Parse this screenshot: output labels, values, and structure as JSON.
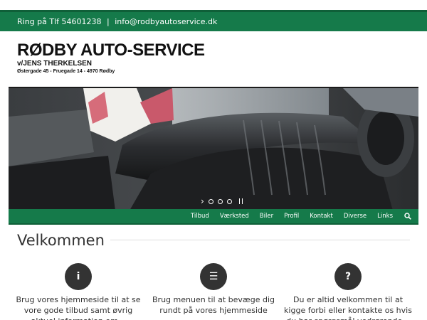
{
  "topbar": {
    "phone": "Ring på Tlf 54601238",
    "separator": "|",
    "email": "info@rodbyautoservice.dk"
  },
  "logo": {
    "title": "RØDBY AUTO-SERVICE",
    "subtitle": "v/JENS THERKELSEN",
    "address": "Østergade 45 - Fruegade 14 - 4970 Rødby"
  },
  "hero": {
    "next_arrow": "›",
    "dot_count": 3
  },
  "nav": {
    "items": [
      {
        "label": "Tilbud"
      },
      {
        "label": "Værksted"
      },
      {
        "label": "Biler"
      },
      {
        "label": "Profil"
      },
      {
        "label": "Kontakt"
      },
      {
        "label": "Diverse"
      },
      {
        "label": "Links"
      }
    ],
    "search_icon": "search-icon"
  },
  "welcome": {
    "title": "Velkommen"
  },
  "features": [
    {
      "icon": "info-icon",
      "glyph": "i",
      "text": "Brug vores hjemmeside til at se vore gode tilbud samt øvrig aktuel information om..."
    },
    {
      "icon": "menu-icon",
      "glyph": "☰",
      "text": "Brug menuen til at bevæge dig rundt på vores hjemmeside"
    },
    {
      "icon": "question-icon",
      "glyph": "?",
      "text": "Du er altid velkommen til at kigge forbi eller kontakte os hvis du har spørgsmål vedrørende..."
    }
  ],
  "colors": {
    "brand_green": "#157a4a",
    "dark_circle": "#333333"
  }
}
